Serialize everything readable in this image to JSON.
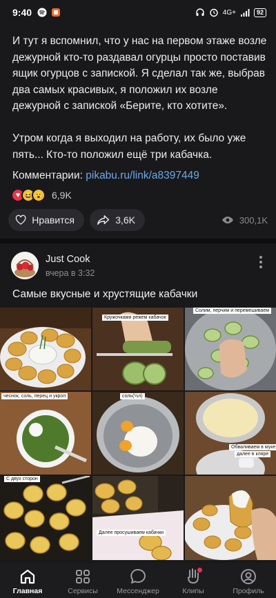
{
  "status_bar": {
    "time": "9:40",
    "network": "4G+",
    "battery": "92"
  },
  "post": {
    "paragraphs": [
      "И тут я вспомнил, что у нас на первом этаже возле дежурной кто-то раздавал огурцы просто поставив ящик огурцов с запиской. Я сделал так же, выбрав два самых красивых, я положил их возле дежурной с запиской «Берите, кто хотите».",
      "Утром когда я выходил на работу, их было уже пять... Кто-то положил ещё три кабачка."
    ],
    "comments_label": "Комментарии:",
    "comments_link": "pikabu.ru/link/a8397449",
    "reactions_count": "6,9K",
    "like_label": "Нравится",
    "share_count": "3,6K",
    "views_count": "300,1K"
  },
  "next_post": {
    "author": "Just Cook",
    "time": "вчера в 3:32",
    "title": "Самые вкусные и хрустящие кабачки",
    "captions": {
      "c2": "Кружочками режем кабачок",
      "c3": "Солим, перчим и перемешиваем",
      "c4": "чеснок, соль, перец и укроп",
      "c5": "соль(½л)",
      "c6a": "Обваливаем в муке,",
      "c6b": "далее в кляре",
      "c7": "С двух сторон",
      "c8": "Далее просушиваем кабачки"
    }
  },
  "bottom_nav": [
    {
      "label": "Главная",
      "active": true
    },
    {
      "label": "Сервисы",
      "active": false
    },
    {
      "label": "Мессенджер",
      "active": false
    },
    {
      "label": "Клипы",
      "active": false
    },
    {
      "label": "Профиль",
      "active": false
    }
  ],
  "colors": {
    "background": "#19191b",
    "link": "#6ea8e6",
    "accent_red": "#e8344a"
  }
}
